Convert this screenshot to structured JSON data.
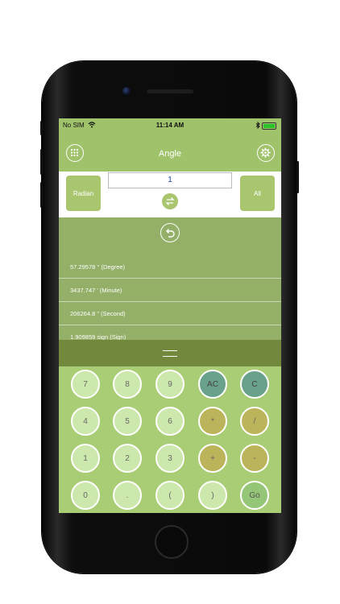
{
  "status_bar": {
    "carrier": "No SIM",
    "time": "11:14 AM"
  },
  "nav": {
    "title": "Angle",
    "menu_icon": "grid-icon",
    "settings_icon": "gear-icon"
  },
  "converter": {
    "from_unit": "Radian",
    "to_unit": "All",
    "input_value": "1"
  },
  "results": [
    "57.29578 ° (Degree)",
    "3437.747 ' (Minute)",
    "206264.8 \" (Second)",
    "1.909859 sign (Sign)"
  ],
  "keypad": {
    "rows": [
      [
        "7",
        "8",
        "9",
        "AC",
        "C"
      ],
      [
        "4",
        "5",
        "6",
        "*",
        "/"
      ],
      [
        "1",
        "2",
        "3",
        "+",
        "-"
      ],
      [
        "0",
        ".",
        "(",
        ")",
        "Go"
      ]
    ]
  },
  "colors": {
    "nav_bg": "#9fc26a",
    "results_bg": "#93af68",
    "keypad_bg": "#a9cd74",
    "number_key": "#cde8ac",
    "clear_key": "#6aa18b",
    "operator_key": "#bcb45a",
    "go_key": "#95c577"
  }
}
